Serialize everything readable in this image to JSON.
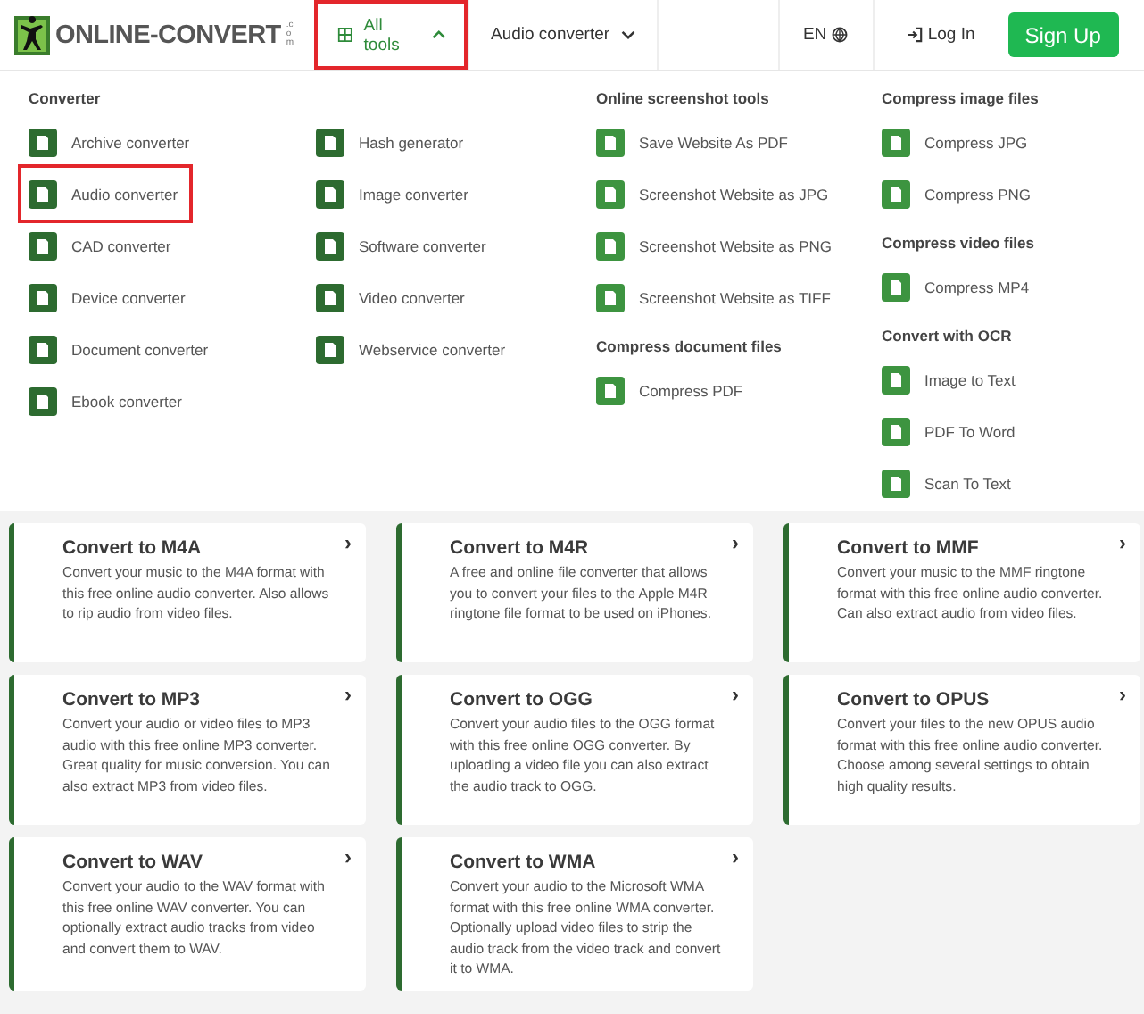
{
  "header": {
    "logo": {
      "name": "ONLINE-CONVERT",
      "suffix": ".com"
    },
    "nav": [
      {
        "label": "All tools",
        "kind": "grid",
        "expanded": true,
        "highlighted": true
      },
      {
        "label": "Audio converter",
        "kind": "plain",
        "expanded": false,
        "highlighted": false
      }
    ],
    "language": "EN",
    "login": "Log In",
    "signup": "Sign Up"
  },
  "menu": {
    "columns": [
      {
        "groups": [
          {
            "heading": "Converter",
            "items": [
              {
                "label": "Archive converter",
                "highlighted": false
              },
              {
                "label": "Audio converter",
                "highlighted": true
              },
              {
                "label": "CAD converter",
                "highlighted": false
              },
              {
                "label": "Device converter",
                "highlighted": false
              },
              {
                "label": "Document converter",
                "highlighted": false
              },
              {
                "label": "Ebook converter",
                "highlighted": false
              }
            ]
          }
        ]
      },
      {
        "groups": [
          {
            "items": [
              {
                "label": "Hash generator",
                "highlighted": false
              },
              {
                "label": "Image converter",
                "highlighted": false
              },
              {
                "label": "Software converter",
                "highlighted": false
              },
              {
                "label": "Video converter",
                "highlighted": false
              },
              {
                "label": "Webservice converter",
                "highlighted": false
              }
            ]
          }
        ]
      },
      {
        "groups": [
          {
            "heading": "Online screenshot tools",
            "items": [
              {
                "label": "Save Website As PDF",
                "highlighted": false
              },
              {
                "label": "Screenshot Website as JPG",
                "highlighted": false
              },
              {
                "label": "Screenshot Website as PNG",
                "highlighted": false
              },
              {
                "label": "Screenshot Website as TIFF",
                "highlighted": false
              }
            ]
          },
          {
            "heading": "Compress document files",
            "items": [
              {
                "label": "Compress PDF",
                "highlighted": false
              }
            ]
          }
        ]
      },
      {
        "groups": [
          {
            "heading": "Compress image files",
            "items": [
              {
                "label": "Compress JPG",
                "highlighted": false
              },
              {
                "label": "Compress PNG",
                "highlighted": false
              }
            ]
          },
          {
            "heading": "Compress video files",
            "items": [
              {
                "label": "Compress MP4",
                "highlighted": false
              }
            ]
          },
          {
            "heading": "Convert with OCR",
            "items": [
              {
                "label": "Image to Text",
                "highlighted": false
              },
              {
                "label": "PDF To Word",
                "highlighted": false
              },
              {
                "label": "Scan To Text",
                "highlighted": false
              }
            ]
          }
        ]
      }
    ]
  },
  "cards": [
    {
      "title": "Convert to M4A",
      "text": "Convert your music to the M4A format with this free online audio converter. Also allows to rip audio from video files.",
      "arrow": "›"
    },
    {
      "title": "Convert to M4R",
      "text": "A free and online file converter that allows you to convert your files to the Apple M4R ringtone file format to be used on iPhones.",
      "arrow": "›"
    },
    {
      "title": "Convert to MMF",
      "text": "Convert your music to the MMF ringtone format with this free online audio converter. Can also extract audio from video files.",
      "arrow": "›"
    },
    {
      "title": "Convert to MP3",
      "text": "Convert your audio or video files to MP3 audio with this free online MP3 converter. Great quality for music conversion. You can also extract MP3 from video files.",
      "arrow": "›"
    },
    {
      "title": "Convert to OGG",
      "text": "Convert your audio files to the OGG format with this free online OGG converter. By uploading a video file you can also extract the audio track to OGG.",
      "arrow": "›"
    },
    {
      "title": "Convert to OPUS",
      "text": "Convert your files to the new OPUS audio format with this free online audio converter. Choose among several settings to obtain high quality results.",
      "arrow": "›"
    },
    {
      "title": "Convert to WAV",
      "text": "Convert your audio to the WAV format with this free online WAV converter. You can optionally extract audio tracks from video and convert them to WAV.",
      "arrow": "›"
    },
    {
      "title": "Convert to WMA",
      "text": "Convert your audio to the Microsoft WMA format with this free online WMA converter. Optionally upload video files to strip the audio track from the video track and convert it to WMA.",
      "arrow": "›"
    }
  ]
}
